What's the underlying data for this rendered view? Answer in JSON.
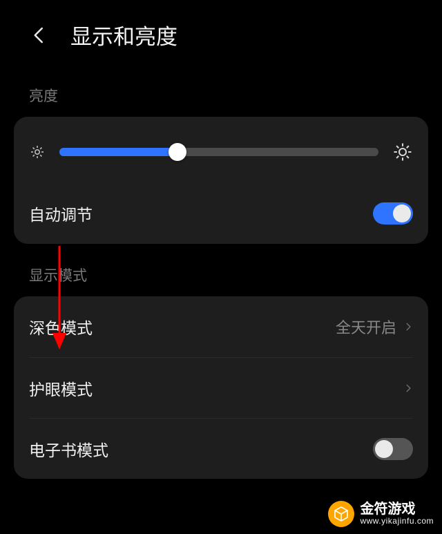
{
  "header": {
    "title": "显示和亮度"
  },
  "brightness": {
    "section_label": "亮度",
    "slider_percent": 37,
    "auto_label": "自动调节",
    "auto_on": true
  },
  "display_mode": {
    "section_label": "显示模式",
    "dark_mode": {
      "label": "深色模式",
      "value": "全天开启"
    },
    "eye_care": {
      "label": "护眼模式"
    },
    "ebook": {
      "label": "电子书模式",
      "on": false
    }
  },
  "annotation": {
    "arrow_color": "#ff0000"
  },
  "watermark": {
    "title": "金符游戏",
    "url": "www.yikajinfu.com"
  }
}
